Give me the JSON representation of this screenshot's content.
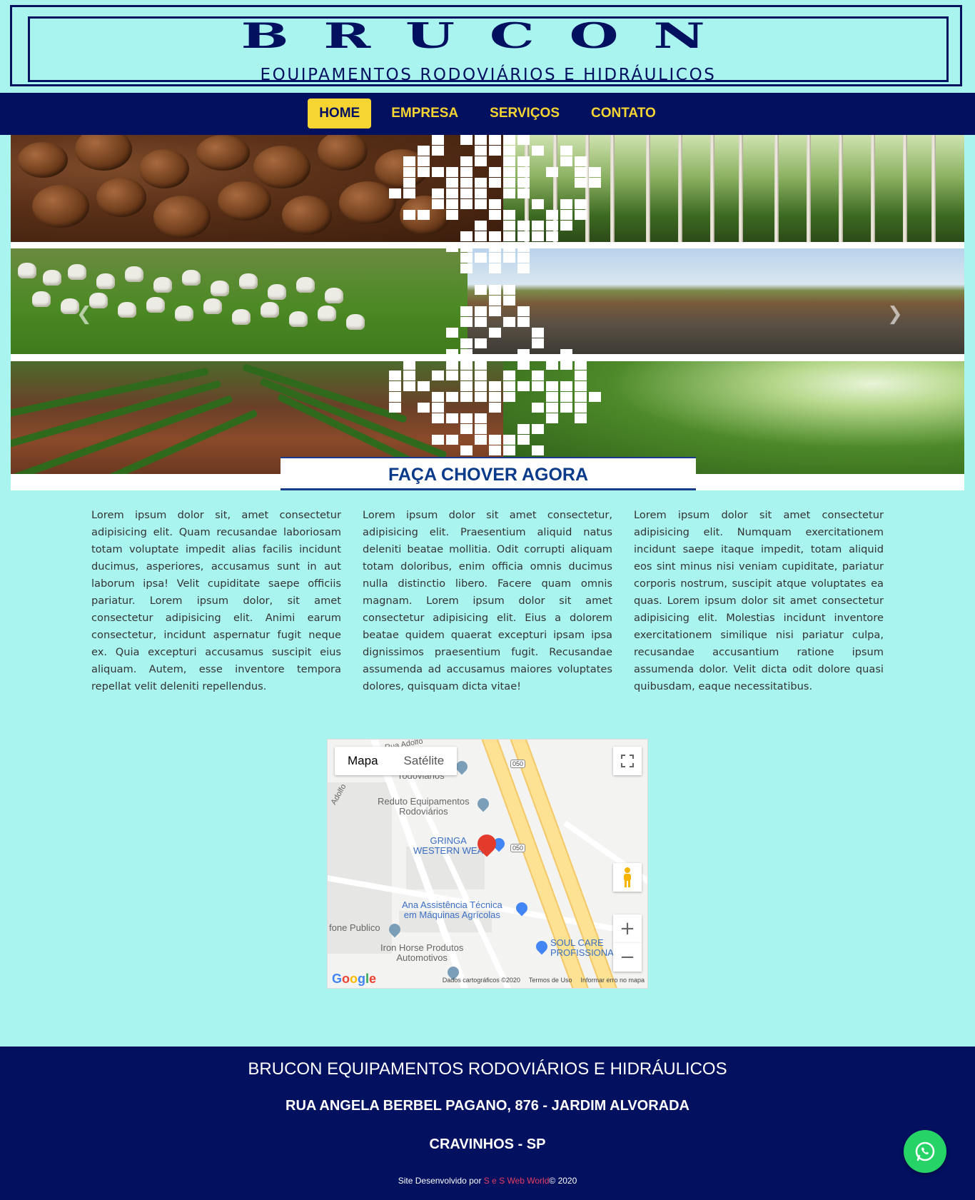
{
  "header": {
    "logo_word": "BRUCON",
    "logo_subtitle": "EQUIPAMENTOS RODOVIÁRIOS E HIDRÁULICOS"
  },
  "nav": {
    "items": [
      {
        "label": "HOME",
        "active": true
      },
      {
        "label": "EMPRESA",
        "active": false
      },
      {
        "label": "SERVIÇOS",
        "active": false
      },
      {
        "label": "CONTATO",
        "active": false
      }
    ]
  },
  "banner": {
    "slogan": "FAÇA CHOVER AGORA",
    "prev_icon": "chevron-left-icon",
    "next_icon": "chevron-right-icon"
  },
  "columns": [
    "Lorem ipsum dolor sit, amet consectetur adipisicing elit. Quam recusandae laboriosam totam voluptate impedit alias facilis incidunt ducimus, asperiores, accusamus sunt in aut laborum ipsa! Velit cupiditate saepe officiis pariatur. Lorem ipsum dolor, sit amet consectetur adipisicing elit. Animi earum consectetur, incidunt aspernatur fugit neque ex. Quia excepturi accusamus suscipit eius aliquam. Autem, esse inventore tempora repellat velit deleniti repellendus.",
    "Lorem ipsum dolor sit amet consectetur, adipisicing elit. Praesentium aliquid natus deleniti beatae mollitia. Odit corrupti aliquam totam doloribus, enim officia omnis ducimus nulla distinctio libero. Facere quam omnis magnam. Lorem ipsum dolor sit amet consectetur adipisicing elit. Eius a dolorem beatae quidem quaerat excepturi ipsam ipsa dignissimos praesentium fugit. Recusandae assumenda ad accusamus maiores voluptates dolores, quisquam dicta vitae!",
    "Lorem ipsum dolor sit amet consectetur adipisicing elit. Numquam exercitationem incidunt saepe itaque impedit, totam aliquid eos sint minus nisi veniam cupiditate, pariatur corporis nostrum, suscipit atque voluptates ea quas. Lorem ipsum dolor sit amet consectetur adipisicing elit. Molestias incidunt inventore exercitationem similique nisi pariatur culpa, recusandae accusantium ratione ipsum assumenda dolor. Velit dicta odit dolore quasi quibusdam, eaque necessitatibus."
  ],
  "map": {
    "type_buttons": [
      "Mapa",
      "Satélite"
    ],
    "selected_type": "Mapa",
    "pois": {
      "reduto": "Reduto Equipamentos\nRodoviários",
      "rodoviarios_top": "rodoviarios",
      "gringa": "GRINGA\nWESTERN WEA",
      "ana": "Ana Assistência Técnica\nem Máquinas Agrícolas",
      "fone": "fone Publico",
      "iron": "Iron Horse Produtos\nAutomotivos",
      "soul": "SOUL CARE\nPROFISSIONA",
      "street_top": "Rua Adolfo",
      "street_left": "Adolfo"
    },
    "highway_shield": "050",
    "zoom_in": "+",
    "zoom_out": "−",
    "google_logo": "Google",
    "footer_data": "Dados cartográficos ©2020",
    "footer_terms": "Termos de Uso",
    "footer_report": "Informar erro no mapa",
    "icons": [
      "fullscreen-icon",
      "pegman-icon",
      "map-pin-icon"
    ]
  },
  "footer": {
    "company": "BRUCON EQUIPAMENTOS RODOVIÁRIOS E HIDRÁULICOS",
    "address": "RUA ANGELA BERBEL PAGANO, 876 - JARDIM ALVORADA",
    "city": "CRAVINHOS - SP",
    "credit_prefix": "Site Desenvolvido por",
    "credit_brand": "S e S Web World",
    "credit_suffix": "© 2020",
    "whatsapp_icon": "whatsapp-icon"
  },
  "colors": {
    "background": "#aaf4ef",
    "navy": "#021060",
    "nav_yellow": "#f6d533",
    "slogan_blue": "#0a3a8a",
    "whatsapp_green": "#25d366",
    "credit_pink": "#e83d5f"
  }
}
